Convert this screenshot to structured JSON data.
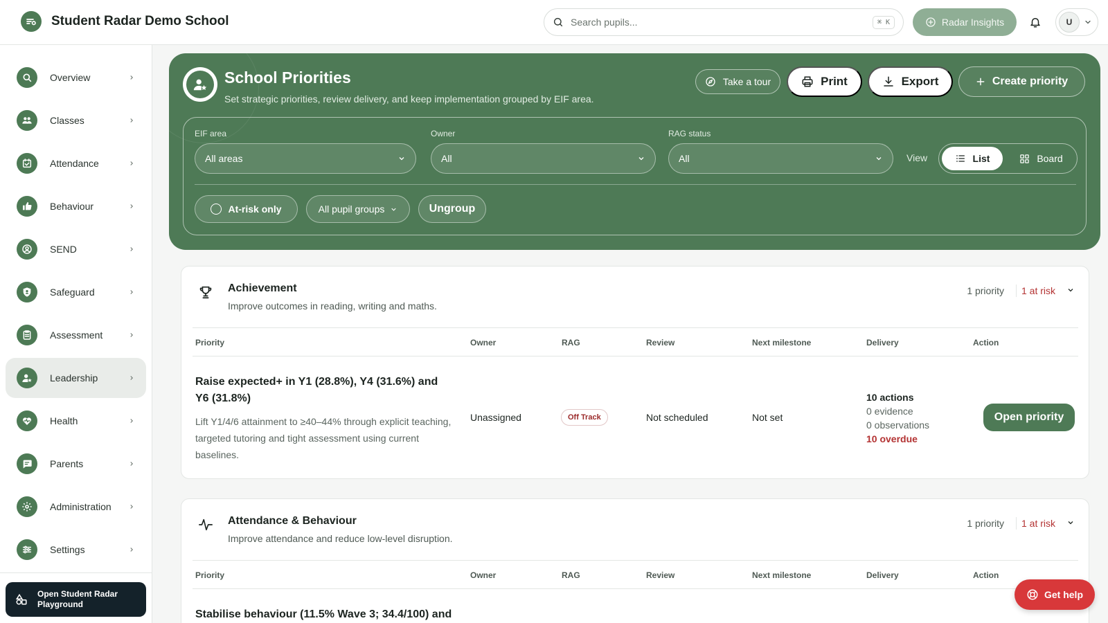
{
  "app": {
    "name": "Student Radar Demo School"
  },
  "topbar": {
    "search_placeholder": "Search pupils...",
    "search_shortcut": "⌘ K",
    "insights_label": "Radar Insights",
    "user_initial": "U"
  },
  "sidebar": {
    "items": [
      {
        "label": "Overview",
        "icon": "search-icon"
      },
      {
        "label": "Classes",
        "icon": "users-icon"
      },
      {
        "label": "Attendance",
        "icon": "calendar-check-icon"
      },
      {
        "label": "Behaviour",
        "icon": "thumbs-up-icon"
      },
      {
        "label": "SEND",
        "icon": "user-circle-icon"
      },
      {
        "label": "Safeguard",
        "icon": "shield-icon"
      },
      {
        "label": "Assessment",
        "icon": "clipboard-icon"
      },
      {
        "label": "Leadership",
        "icon": "user-star-icon",
        "active": true
      },
      {
        "label": "Health",
        "icon": "heart-pulse-icon"
      },
      {
        "label": "Parents",
        "icon": "message-icon"
      },
      {
        "label": "Administration",
        "icon": "gear-icon"
      },
      {
        "label": "Settings",
        "icon": "sliders-icon"
      }
    ],
    "playground_label": "Open Student Radar Playground"
  },
  "hero": {
    "title": "School Priorities",
    "subtitle": "Set strategic priorities, review delivery, and keep implementation grouped by EIF area.",
    "tour_label": "Take a tour",
    "print_label": "Print",
    "export_label": "Export",
    "create_label": "Create priority"
  },
  "filters": {
    "eif_label": "EIF area",
    "eif_value": "All areas",
    "owner_label": "Owner",
    "owner_value": "All",
    "rag_label": "RAG status",
    "rag_value": "All",
    "view_label": "View",
    "view_list": "List",
    "view_board": "Board",
    "at_risk_label": "At-risk only",
    "pupil_groups_label": "All pupil groups",
    "ungroup_label": "Ungroup"
  },
  "table_headers": {
    "priority": "Priority",
    "owner": "Owner",
    "rag": "RAG",
    "review": "Review",
    "next_milestone": "Next milestone",
    "delivery": "Delivery",
    "action": "Action"
  },
  "groups": [
    {
      "title": "Achievement",
      "description": "Improve outcomes in reading, writing and maths.",
      "icon": "trophy-icon",
      "count": "1 priority",
      "at_risk": "1 at risk",
      "priority": {
        "title": "Raise expected+ in Y1 (28.8%), Y4 (31.6%) and Y6 (31.8%)",
        "description": "Lift Y1/4/6 attainment to ≥40–44% through explicit teaching, targeted tutoring and tight assessment using current baselines.",
        "owner": "Unassigned",
        "rag": "Off Track",
        "review": "Not scheduled",
        "next_milestone": "Not set",
        "delivery_actions": "10 actions",
        "delivery_evidence": "0 evidence",
        "delivery_observations": "0 observations",
        "delivery_overdue": "10 overdue",
        "action_label": "Open priority"
      }
    },
    {
      "title": "Attendance & Behaviour",
      "description": "Improve attendance and reduce low-level disruption.",
      "icon": "activity-icon",
      "count": "1 priority",
      "at_risk": "1 at risk",
      "priority": {
        "title": "Stabilise behaviour (11.5% Wave 3; 34.4/100) and"
      }
    }
  ],
  "help": {
    "label": "Get help"
  },
  "colors": {
    "brand_green": "#4e7a56",
    "risk_red": "#b33232",
    "help_red": "#d8383a",
    "playground_dark": "#14222a"
  }
}
